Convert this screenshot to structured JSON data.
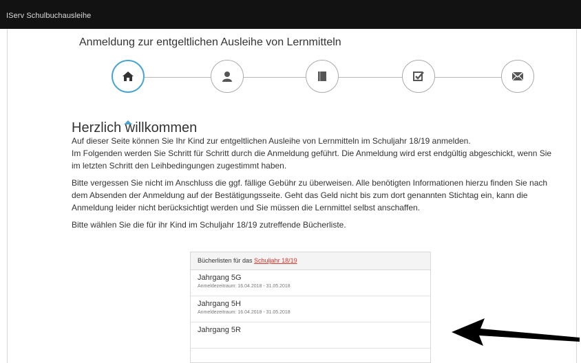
{
  "app": {
    "name": "IServ Schulbuchausleihe"
  },
  "page": {
    "title": "Anmeldung zur entgeltlichen Ausleihe von Lernmitteln"
  },
  "stepper": {
    "steps": [
      {
        "icon": "home-icon",
        "active": true
      },
      {
        "icon": "user-icon",
        "active": false
      },
      {
        "icon": "book-icon",
        "active": false
      },
      {
        "icon": "check-square-icon",
        "active": false
      },
      {
        "icon": "envelope-icon",
        "active": false
      }
    ],
    "accent": "#4aa4d1"
  },
  "welcome": {
    "heading": "Herzlich willkommen",
    "paragraph1_line1": "Auf dieser Seite können Sie Ihr Kind zur entgeltlichen Ausleihe von Lernmitteln im Schuljahr 18/19 anmelden.",
    "paragraph1_line2": "Im Folgenden werden Sie Schritt für Schritt durch die Anmeldung geführt. Die Anmeldung wird erst endgültig abgeschickt, wenn Sie im letzten Schritt den Leihbedingungen zugestimmt haben.",
    "paragraph2": "Bitte vergessen Sie nicht im Anschluss die ggf. fällige Gebühr zu überweisen. Alle benötigten Informationen hierzu finden Sie nach dem Absenden der Anmeldung auf der Bestätigungsseite. Geht das Geld nicht bis zum dort genannten Stichtag ein, kann die Anmeldung leider nicht berücksichtigt werden und Sie müssen die Lernmittel selbst anschaffen.",
    "paragraph3": "Bitte wählen Sie die für ihr Kind im Schuljahr 18/19 zutreffende Bücherliste."
  },
  "booklists": {
    "heading_prefix": "Bücherlisten für das ",
    "heading_link": "Schuljahr 18/19",
    "items": [
      {
        "title": "Jahrgang 5G",
        "period": "Anmeldezeitraum: 16.04.2018 - 31.05.2018"
      },
      {
        "title": "Jahrgang 5H",
        "period": "Anmeldezeitraum: 16.04.2018 - 31.05.2018"
      },
      {
        "title": "Jahrgang 5R",
        "period": ""
      }
    ]
  },
  "colors": {
    "topbar": "#121212",
    "link": "#d9342b",
    "arrow": "#000000"
  }
}
